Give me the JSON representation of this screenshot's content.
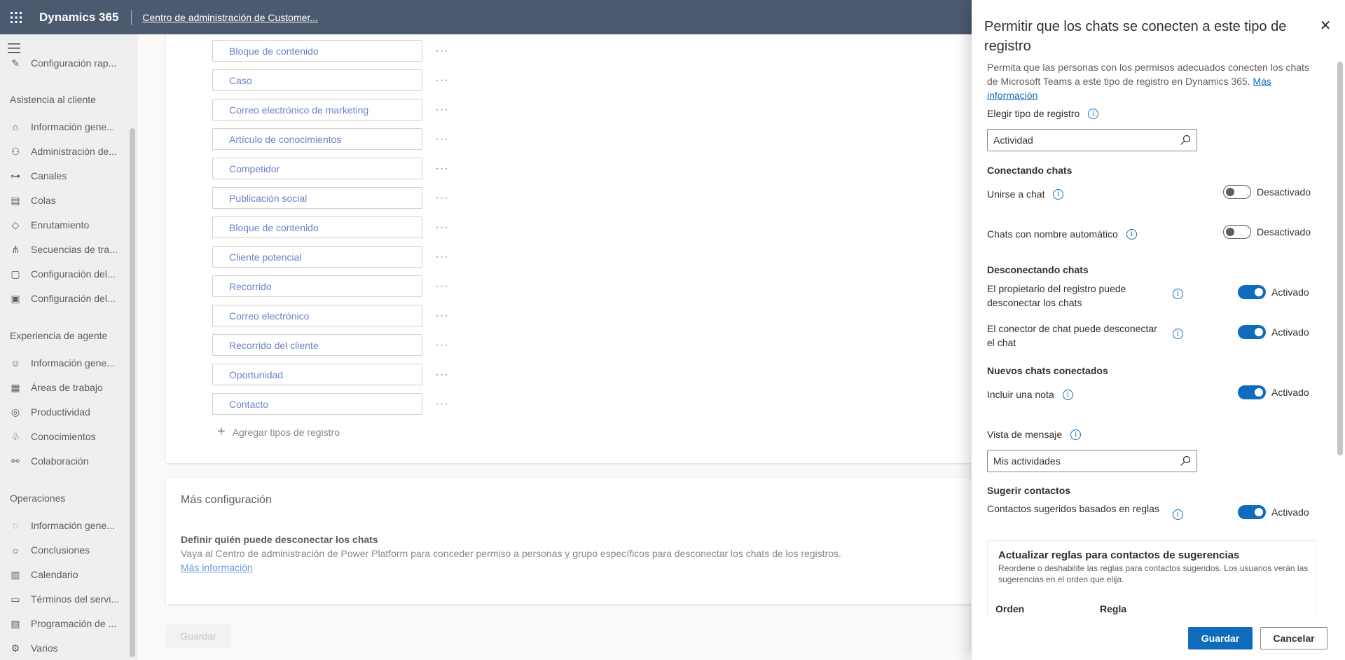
{
  "topbar": {
    "brand": "Dynamics 365",
    "app_title": "Centro de administración de Customer..."
  },
  "sidebar": {
    "top_item": "Configuración rap...",
    "sections": [
      {
        "title": "Asistencia al cliente",
        "items": [
          {
            "label": "Información gene...",
            "icon": "home-icon"
          },
          {
            "label": "Administración de...",
            "icon": "people-icon"
          },
          {
            "label": "Canales",
            "icon": "channels-icon"
          },
          {
            "label": "Colas",
            "icon": "queue-icon"
          },
          {
            "label": "Enrutamiento",
            "icon": "routing-icon"
          },
          {
            "label": "Secuencias de tra...",
            "icon": "sequence-icon"
          },
          {
            "label": "Configuración del...",
            "icon": "briefcase-icon"
          },
          {
            "label": "Configuración del...",
            "icon": "contact-card-icon"
          }
        ]
      },
      {
        "title": "Experiencia de agente",
        "items": [
          {
            "label": "Información gene...",
            "icon": "person-icon"
          },
          {
            "label": "Áreas de trabajo",
            "icon": "workspace-icon"
          },
          {
            "label": "Productividad",
            "icon": "productivity-icon"
          },
          {
            "label": "Conocimientos",
            "icon": "knowledge-icon"
          },
          {
            "label": "Colaboración",
            "icon": "collaboration-icon"
          }
        ]
      },
      {
        "title": "Operaciones",
        "items": [
          {
            "label": "Información gene...",
            "icon": "overview-icon"
          },
          {
            "label": "Conclusiones",
            "icon": "lightbulb-icon"
          },
          {
            "label": "Calendario",
            "icon": "calendar-icon"
          },
          {
            "label": "Términos del servi...",
            "icon": "terms-icon"
          },
          {
            "label": "Programación de ...",
            "icon": "schedule-icon"
          },
          {
            "label": "Varios",
            "icon": "gear-icon"
          }
        ]
      }
    ]
  },
  "main": {
    "record_types": [
      "Bloque de contenido",
      "Caso",
      "Correo electrónico de marketing",
      "Artículo de conocimientos",
      "Competidor",
      "Publicación social",
      "Bloque de contenido",
      "Cliente potencial",
      "Recorrido",
      "Correo electrónico",
      "Recorrido del cliente",
      "Oportunidad",
      "Contacto"
    ],
    "more_label": "···",
    "add_types_label": "Agregar tipos de registro",
    "more_config": {
      "title": "Más configuración",
      "subtitle": "Definir quién puede desconectar los chats",
      "description": "Vaya al Centro de administración de Power Platform para conceder permiso a personas y grupo específicos para desconectar los chats de los registros.",
      "link": "Más información"
    },
    "save_label": "Guardar"
  },
  "panel": {
    "title": "Permitir que los chats se conecten a este tipo de registro",
    "description": "Permita que las personas con los permisos adecuados conecten los chats de Microsoft Teams a este tipo de registro en Dynamics 365.",
    "description_link": "Más información",
    "choose_type_label": "Elegir tipo de registro",
    "choose_type_value": "Actividad",
    "connecting_heading": "Conectando chats",
    "join_chat_label": "Unirse a chat",
    "join_chat_state": "Desactivado",
    "auto_name_label": "Chats con nombre automático",
    "auto_name_state": "Desactivado",
    "disconnecting_heading": "Desconectando chats",
    "owner_disconnect_label": "El propietario del registro puede desconectar los chats",
    "owner_disconnect_state": "Activado",
    "connector_disconnect_label": "El conector de chat puede desconectar el chat",
    "connector_disconnect_state": "Activado",
    "new_chats_heading": "Nuevos chats conectados",
    "include_note_label": "Incluir una nota",
    "include_note_state": "Activado",
    "message_view_label": "Vista de mensaje",
    "message_view_value": "Mis actividades",
    "suggest_heading": "Sugerir contactos",
    "rule_contacts_label": "Contactos sugeridos basados en reglas",
    "rule_contacts_state": "Activado",
    "rules_box": {
      "title": "Actualizar reglas para contactos de sugerencias",
      "description": "Reordene o deshabilite las reglas para contactos sugeridos. Los usuarios verán las sugerencias en el orden que elija.",
      "col_order": "Orden",
      "col_rule": "Regla"
    },
    "save_label": "Guardar",
    "cancel_label": "Cancelar"
  }
}
